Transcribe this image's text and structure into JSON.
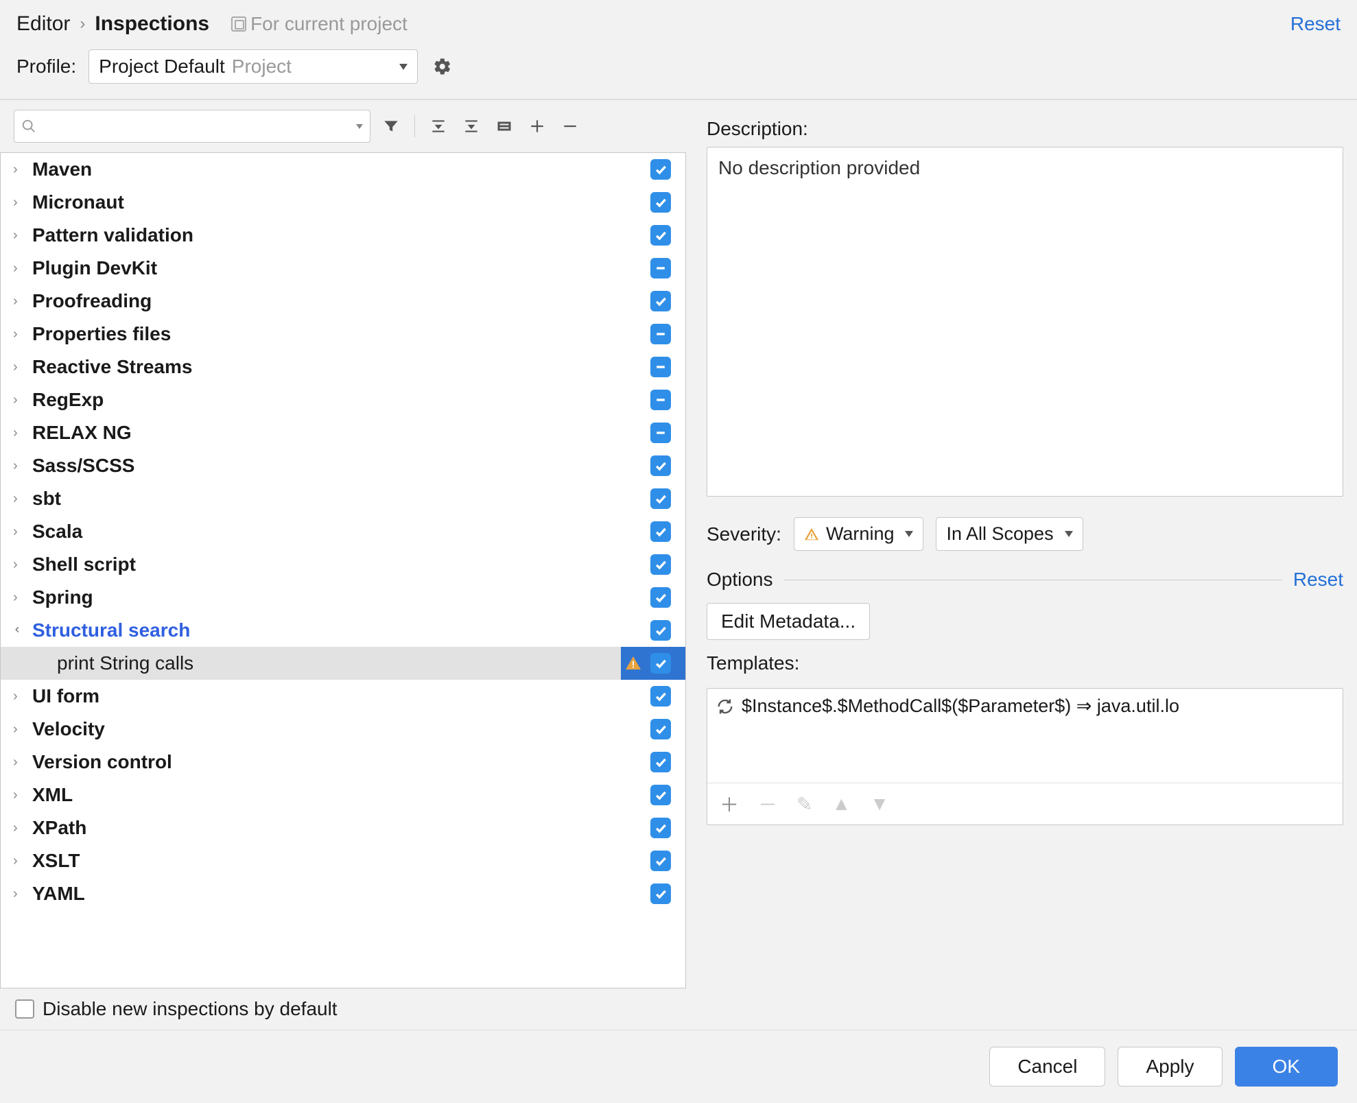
{
  "header": {
    "breadcrumb_parent": "Editor",
    "breadcrumb_current": "Inspections",
    "current_project_label": "For current project",
    "reset_label": "Reset"
  },
  "profile": {
    "label": "Profile:",
    "selected_name": "Project Default",
    "selected_scope": "Project"
  },
  "tree": {
    "items": [
      {
        "label": "Maven",
        "state": "check",
        "expanded": false
      },
      {
        "label": "Micronaut",
        "state": "check",
        "expanded": false
      },
      {
        "label": "Pattern validation",
        "state": "check",
        "expanded": false
      },
      {
        "label": "Plugin DevKit",
        "state": "dash",
        "expanded": false
      },
      {
        "label": "Proofreading",
        "state": "check",
        "expanded": false
      },
      {
        "label": "Properties files",
        "state": "dash",
        "expanded": false
      },
      {
        "label": "Reactive Streams",
        "state": "dash",
        "expanded": false
      },
      {
        "label": "RegExp",
        "state": "dash",
        "expanded": false
      },
      {
        "label": "RELAX NG",
        "state": "dash",
        "expanded": false
      },
      {
        "label": "Sass/SCSS",
        "state": "check",
        "expanded": false
      },
      {
        "label": "sbt",
        "state": "check",
        "expanded": false
      },
      {
        "label": "Scala",
        "state": "check",
        "expanded": false
      },
      {
        "label": "Shell script",
        "state": "check",
        "expanded": false
      },
      {
        "label": "Spring",
        "state": "check",
        "expanded": false
      },
      {
        "label": "Structural search",
        "state": "check",
        "expanded": true,
        "highlighted": true,
        "children": [
          {
            "label": "print String calls",
            "state": "check",
            "selected": true,
            "warning": true
          }
        ]
      },
      {
        "label": "UI form",
        "state": "check",
        "expanded": false
      },
      {
        "label": "Velocity",
        "state": "check",
        "expanded": false
      },
      {
        "label": "Version control",
        "state": "check",
        "expanded": false
      },
      {
        "label": "XML",
        "state": "check",
        "expanded": false
      },
      {
        "label": "XPath",
        "state": "check",
        "expanded": false
      },
      {
        "label": "XSLT",
        "state": "check",
        "expanded": false
      },
      {
        "label": "YAML",
        "state": "check",
        "expanded": false
      }
    ],
    "disable_new_label": "Disable new inspections by default"
  },
  "details": {
    "description_title": "Description:",
    "description_text": "No description provided",
    "severity_label": "Severity:",
    "severity_value": "Warning",
    "scope_value": "In All Scopes",
    "options_label": "Options",
    "options_reset": "Reset",
    "edit_metadata_label": "Edit Metadata...",
    "templates_label": "Templates:",
    "template_text": "$Instance$.$MethodCall$($Parameter$) ⇒ java.util.lo"
  },
  "footer": {
    "cancel": "Cancel",
    "apply": "Apply",
    "ok": "OK"
  }
}
